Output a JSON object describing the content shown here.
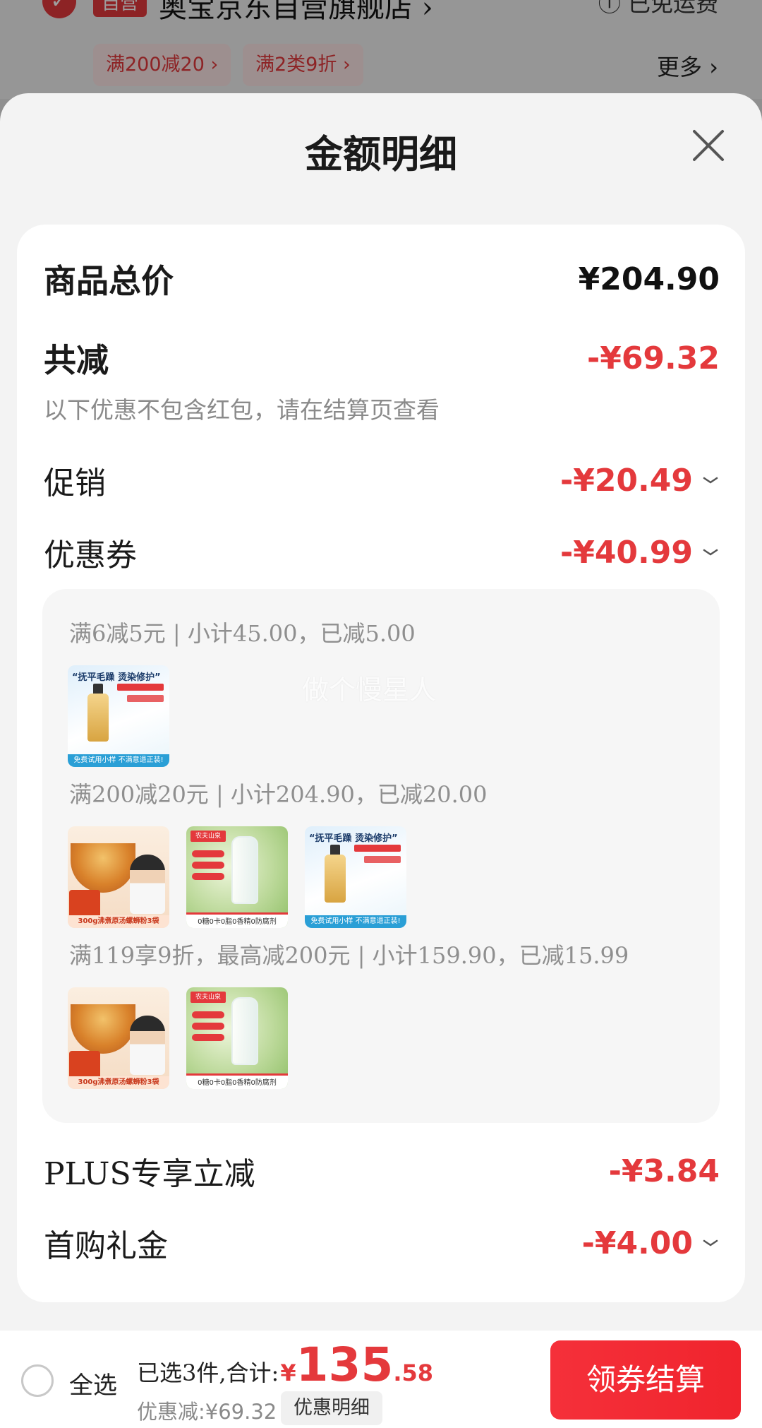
{
  "background": {
    "self_operated_tag": "自营",
    "store_name": "奥宝京东自营旗舰店 ›",
    "free_shipping": "ⓘ 已免运费",
    "promos": [
      "满200减20 ›",
      "满2类9折 ›"
    ],
    "more": "更多 ›"
  },
  "sheet": {
    "title": "金额明细",
    "goods_total": {
      "label": "商品总价",
      "value": "¥204.90"
    },
    "total_discount": {
      "label": "共减",
      "value": "-¥69.32"
    },
    "note": "以下优惠不包含红包，请在结算页查看",
    "promotion": {
      "label": "促销",
      "value": "-¥20.49"
    },
    "coupon": {
      "label": "优惠券",
      "value": "-¥40.99"
    },
    "coupon_groups": [
      {
        "text": "满6减5元 | 小计45.00，已减5.00",
        "items": [
          "hair-oil"
        ]
      },
      {
        "text": "满200减20元 | 小计204.90，已减20.00",
        "items": [
          "noodles",
          "water",
          "hair-oil"
        ]
      },
      {
        "text": "满119享9折，最高减200元 | 小计159.90，已减15.99",
        "items": [
          "noodles",
          "water"
        ]
      }
    ],
    "thumb_text": {
      "hair_headline": "“抚平毛躁 烫染修护”",
      "hair_footer": "免费试用小样 不满意退正装!",
      "noodle_footer": "300g沸煮原汤螺蛳粉3袋",
      "water_brand": "农夫山泉",
      "water_footer": "0糖0卡0脂0香精0防腐剂"
    },
    "watermark": "做个慢星人",
    "plus": {
      "label": "PLUS专享立减",
      "value": "-¥3.84"
    },
    "first_purchase": {
      "label": "首购礼金",
      "value": "-¥4.00"
    }
  },
  "bottom_bar": {
    "select_all": "全选",
    "summary_prefix": "已选3件,合计:",
    "currency": "¥",
    "total_int": "135",
    "total_dec": ".58",
    "discount_text": "优惠减:¥69.32",
    "detail_button": "优惠明细",
    "checkout_button": "领券结算"
  },
  "colors": {
    "accent": "#e4393c",
    "sheet_bg": "#f3f3f3",
    "card_bg": "#ffffff"
  }
}
